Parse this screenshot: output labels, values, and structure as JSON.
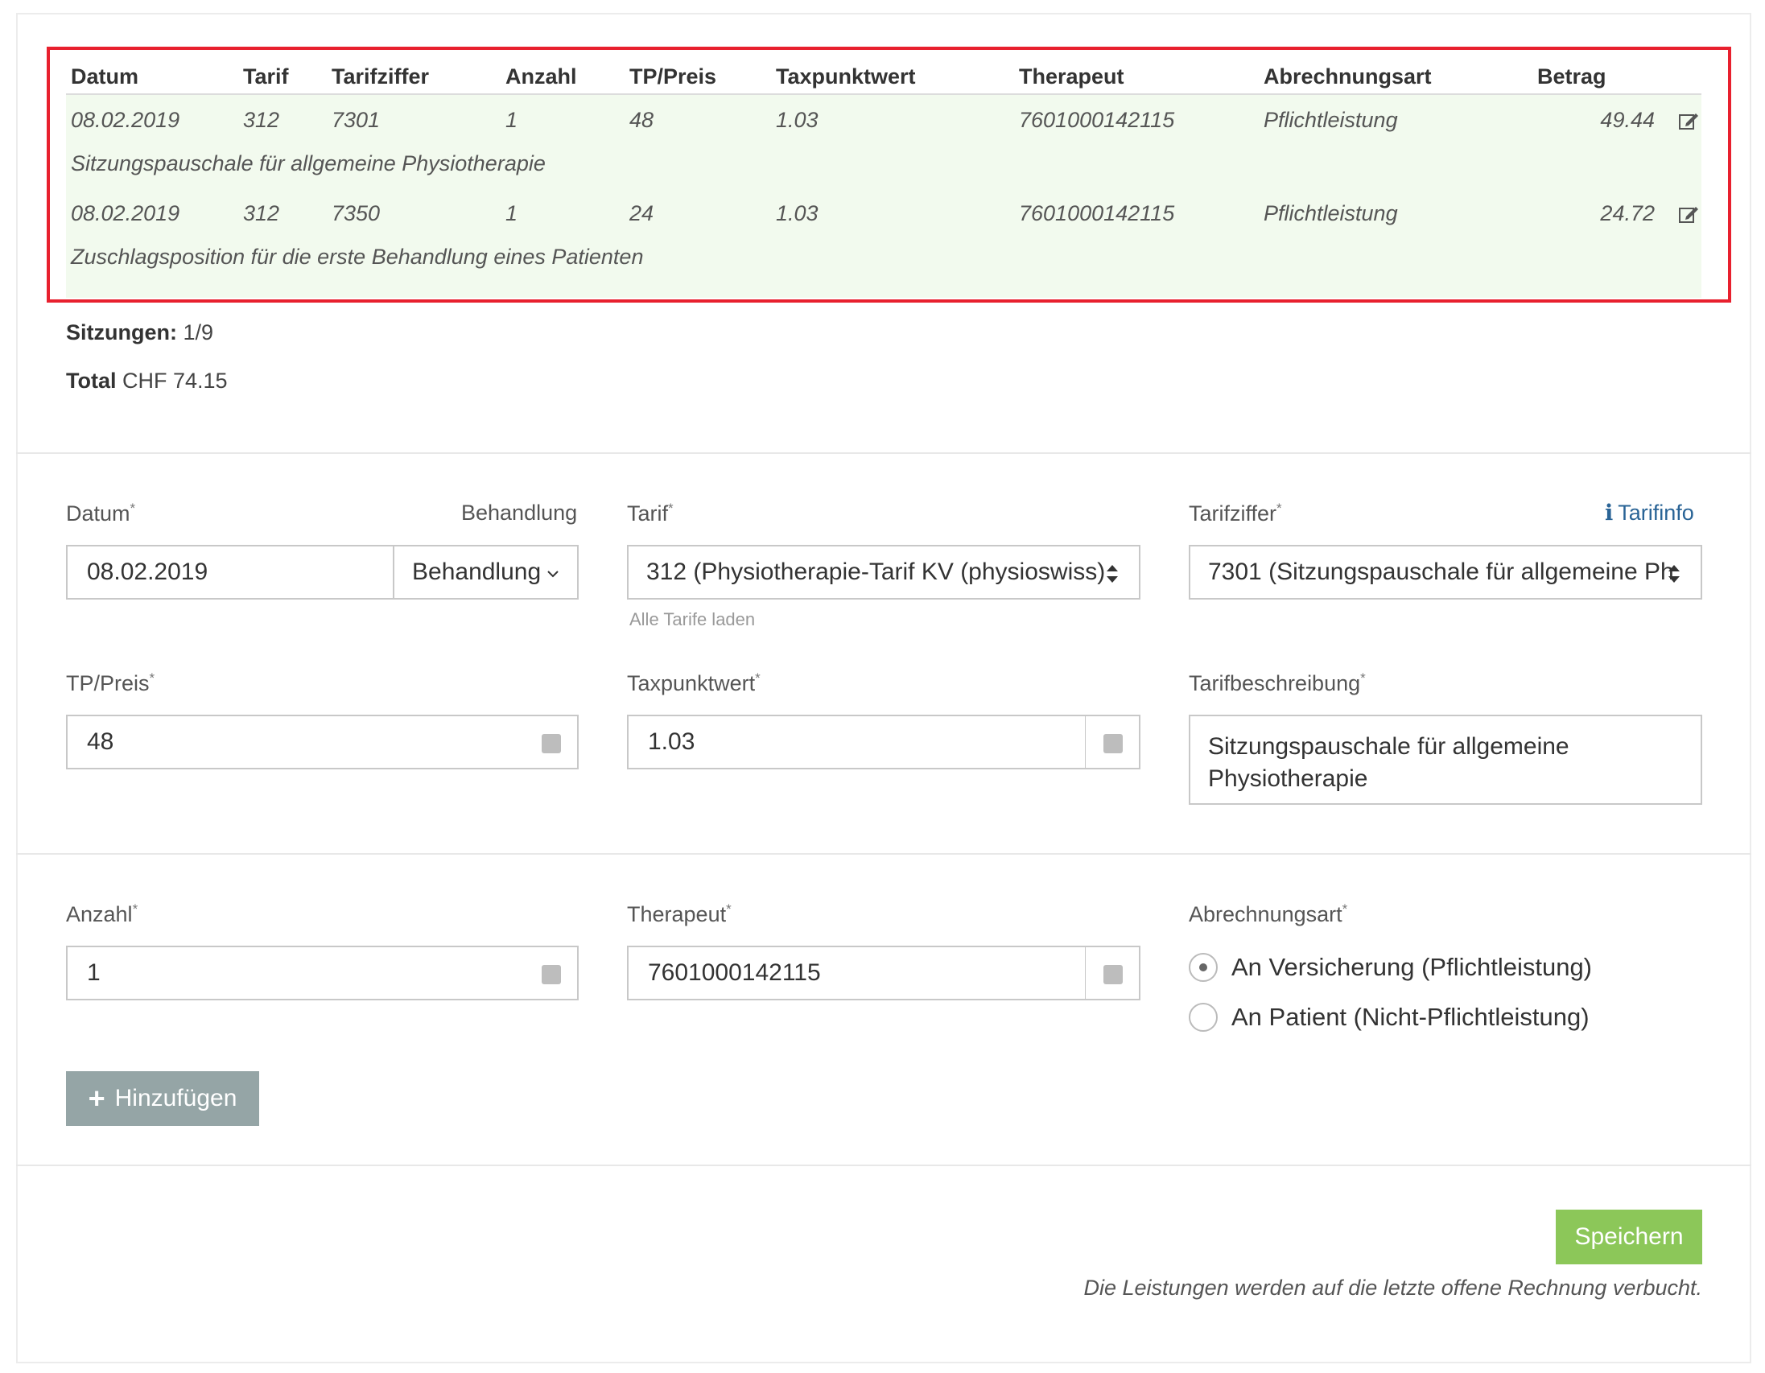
{
  "table": {
    "headers": {
      "datum": "Datum",
      "tarif": "Tarif",
      "tarifziffer": "Tarifziffer",
      "anzahl": "Anzahl",
      "tp_preis": "TP/Preis",
      "taxpunktwert": "Taxpunktwert",
      "therapeut": "Therapeut",
      "abrechnungsart": "Abrechnungsart",
      "betrag": "Betrag"
    },
    "rows": [
      {
        "datum": "08.02.2019",
        "tarif": "312",
        "tarifziffer": "7301",
        "anzahl": "1",
        "tp_preis": "48",
        "taxpunktwert": "1.03",
        "therapeut": "7601000142115",
        "abrechnungsart": "Pflichtleistung",
        "betrag": "49.44",
        "beschreibung": "Sitzungspauschale für allgemeine Physiotherapie"
      },
      {
        "datum": "08.02.2019",
        "tarif": "312",
        "tarifziffer": "7350",
        "anzahl": "1",
        "tp_preis": "24",
        "taxpunktwert": "1.03",
        "therapeut": "7601000142115",
        "abrechnungsart": "Pflichtleistung",
        "betrag": "24.72",
        "beschreibung": "Zuschlagsposition für die erste Behandlung eines Patienten"
      }
    ]
  },
  "summary": {
    "sitzungen_label": "Sitzungen:",
    "sitzungen_value": "1/9",
    "total_label": "Total",
    "total_value": "CHF 74.15"
  },
  "form": {
    "datum": {
      "label": "Datum",
      "required": "*",
      "value": "08.02.2019",
      "behandlung_label": "Behandlung",
      "behandlung_value": "Behandlung"
    },
    "tarif": {
      "label": "Tarif",
      "required": "*",
      "value": "312 (Physiotherapie-Tarif KV (physioswiss)",
      "helper": "Alle Tarife laden"
    },
    "tarifziffer": {
      "label": "Tarifziffer",
      "required": "*",
      "value": "7301 (Sitzungspauschale für allgemeine Ph",
      "info_link": "Tarifinfo",
      "info_icon": "i"
    },
    "tp_preis": {
      "label": "TP/Preis",
      "required": "*",
      "value": "48"
    },
    "taxpunktwert": {
      "label": "Taxpunktwert",
      "required": "*",
      "value": "1.03"
    },
    "tarifbeschreibung": {
      "label": "Tarifbeschreibung",
      "required": "*",
      "value": "Sitzungspauschale für allgemeine Physiotherapie"
    },
    "anzahl": {
      "label": "Anzahl",
      "required": "*",
      "value": "1"
    },
    "therapeut": {
      "label": "Therapeut",
      "required": "*",
      "value": "7601000142115"
    },
    "abrechnungsart": {
      "label": "Abrechnungsart",
      "required": "*",
      "options": [
        "An Versicherung (Pflichtleistung)",
        "An Patient (Nicht-Pflichtleistung)"
      ],
      "selected": "An Versicherung (Pflichtleistung)"
    },
    "add_button": {
      "icon": "+",
      "label": "Hinzufügen"
    }
  },
  "footer": {
    "save_button": "Speichern",
    "note": "Die Leistungen werden auf die letzte offene Rechnung verbucht."
  },
  "colors": {
    "highlight_border": "#e8202e",
    "row_background": "#f2faee",
    "save_button": "#8cc759",
    "add_button": "#95a5a6",
    "link": "#2a6496"
  }
}
